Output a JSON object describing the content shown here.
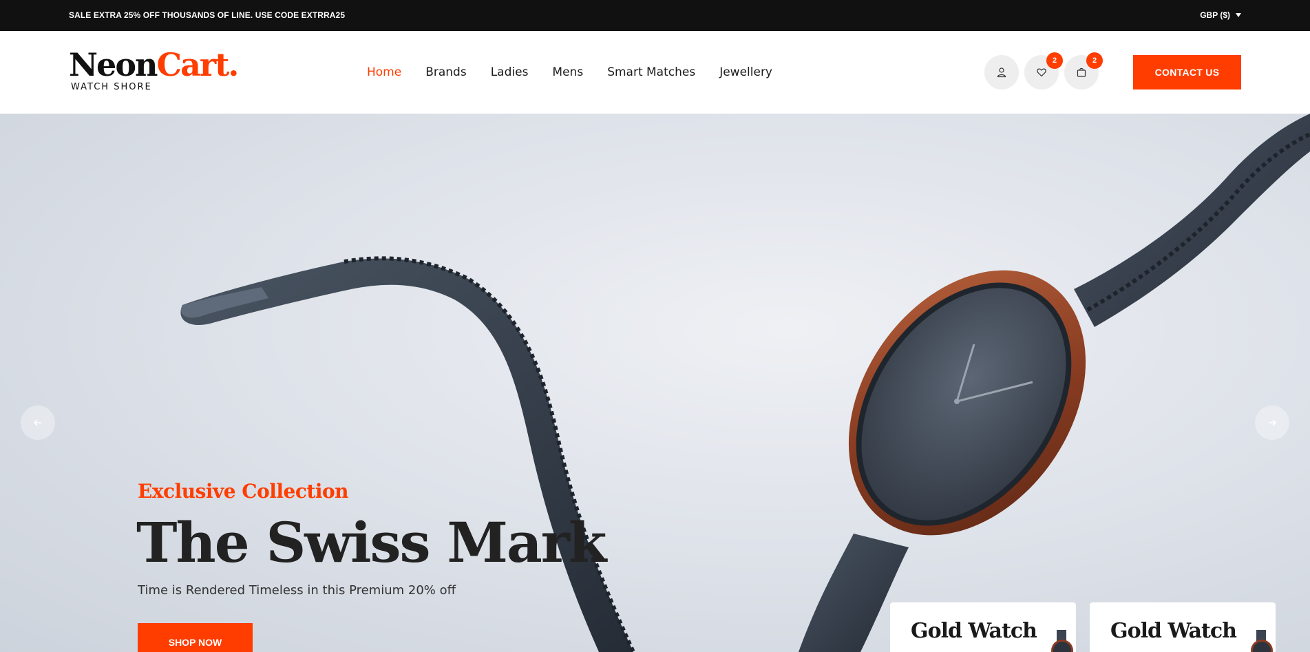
{
  "topbar": {
    "promo": "SALE EXTRA 25% OFF THOUSANDS OF LINE. USE CODE EXTRRA25",
    "currency": "GBP ($)"
  },
  "header": {
    "logo_main_1": "Neon",
    "logo_main_2": "Cart.",
    "logo_sub": "WATCH SHORE",
    "nav": [
      "Home",
      "Brands",
      "Ladies",
      "Mens",
      "Smart Matches",
      "Jewellery"
    ],
    "active_nav": "Home",
    "wishlist_count": "2",
    "cart_count": "2",
    "contact_label": "CONTACT US"
  },
  "hero": {
    "subtitle": "Exclusive Collection",
    "title": "The Swiss Mark",
    "text": "Time is Rendered Timeless in this Premium 20% off",
    "button": "SHOP NOW",
    "cards": [
      "Gold Watch",
      "Gold Watch"
    ]
  },
  "colors": {
    "accent": "#ff3d00",
    "topbar": "#111111",
    "text_dark": "#222222"
  },
  "icons": [
    "user-icon",
    "heart-icon",
    "bag-icon",
    "arrow-left-icon",
    "arrow-right-icon",
    "caret-down-icon"
  ]
}
